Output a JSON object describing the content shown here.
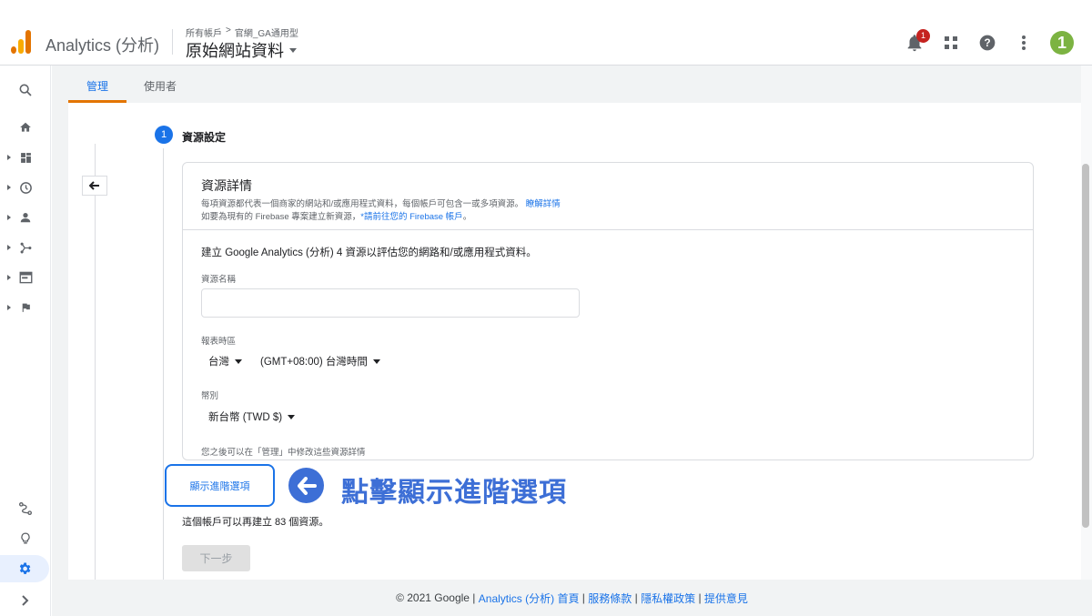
{
  "header": {
    "app_name": "Analytics (分析)",
    "breadcrumb": [
      "所有帳戶",
      ">",
      "官網_GA通用型"
    ],
    "property_name": "原始網站資料",
    "notification_count": "1",
    "step_number": "1"
  },
  "tabs": [
    {
      "label": "管理"
    },
    {
      "label": "使用者"
    }
  ],
  "step": {
    "number": "1",
    "label": "資源設定"
  },
  "card": {
    "title": "資源詳情",
    "desc_line1": "每項資源都代表一個商家的網站和/或應用程式資料，每個帳戶可包含一或多項資源。",
    "desc_link1": "瞭解詳情",
    "desc_line2": "如要為現有的 Firebase 專案建立新資源，",
    "desc_link2": "*請前往您的 Firebase 帳戶",
    "desc_line2_end": "。",
    "intro": "建立 Google Analytics (分析) 4 資源以評估您的網路和/或應用程式資料。",
    "name_label": "資源名稱",
    "name_value": "",
    "timezone_label": "報表時區",
    "country": "台灣",
    "timezone": "(GMT+08:00) 台灣時間",
    "currency_label": "幣別",
    "currency": "新台幣 (TWD $)",
    "note": "您之後可以在「管理」中修改這些資源詳情"
  },
  "advanced_button": "顯示進階選項",
  "annotation": "點擊顯示進階選項",
  "remaining_text": "這個帳戶可以再建立 83 個資源。",
  "next_button": "下一步",
  "footer": {
    "copyright": "© 2021 Google |",
    "home": "Analytics (分析) 首頁",
    "sep1": "|",
    "terms": "服務條款",
    "sep2": "|",
    "privacy": "隱私權政策",
    "sep3": "|",
    "feedback": "提供意見"
  },
  "colors": {
    "accent": "#1a73e8",
    "tab_underline": "#e37400",
    "annotation": "#3d6fd6",
    "badge_green": "#7cb342",
    "notification_red": "#c5221f"
  }
}
